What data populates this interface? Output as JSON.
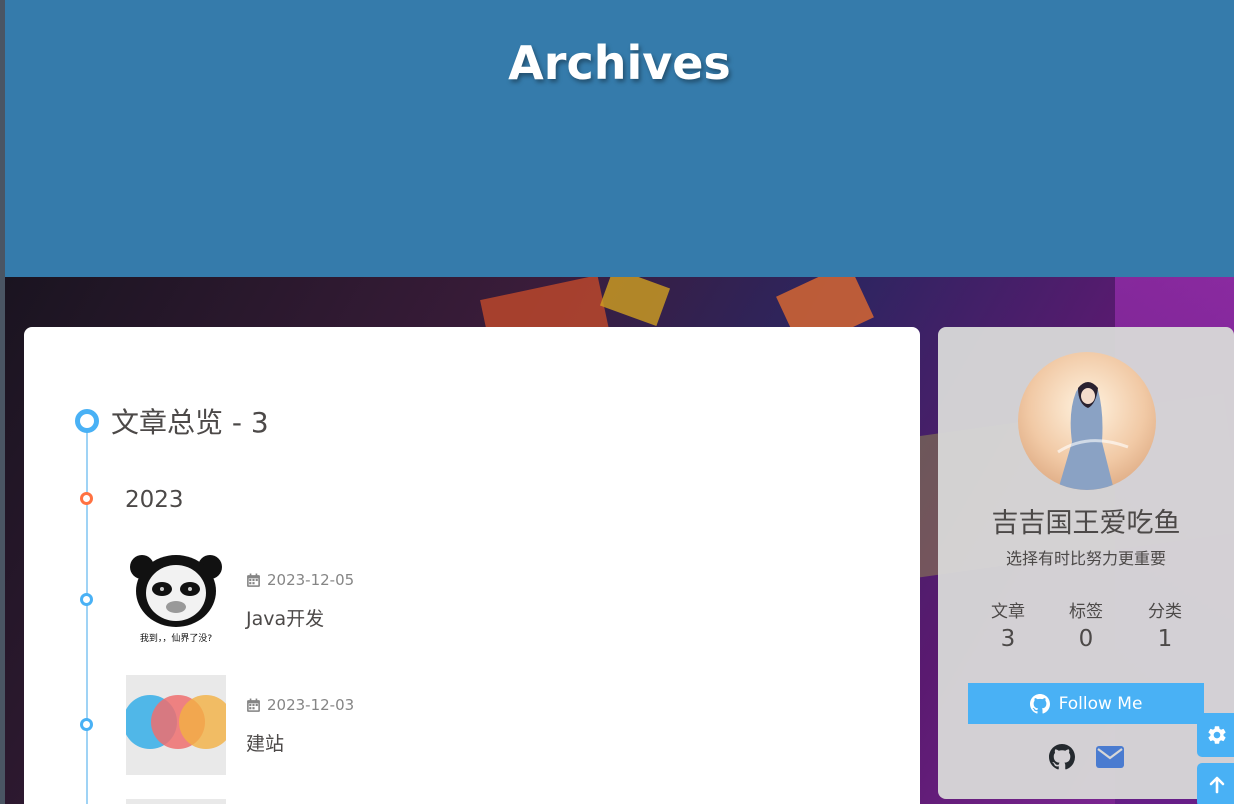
{
  "header": {
    "title": "Archives"
  },
  "archive": {
    "heading": "文章总览 - 3",
    "year": "2023",
    "posts": [
      {
        "date": "2023-12-05",
        "title": "Java开发",
        "thumb_caption": "我到，，仙界了没?"
      },
      {
        "date": "2023-12-03",
        "title": "建站"
      }
    ]
  },
  "sidebar": {
    "author": "吉吉国王爱吃鱼",
    "description": "选择有时比努力更重要",
    "stats": [
      {
        "label": "文章",
        "value": "3"
      },
      {
        "label": "标签",
        "value": "0"
      },
      {
        "label": "分类",
        "value": "1"
      }
    ],
    "follow_label": "Follow Me"
  },
  "colors": {
    "header": "#357bab",
    "accent": "#49b1f5",
    "year_dot": "#ff7242"
  }
}
